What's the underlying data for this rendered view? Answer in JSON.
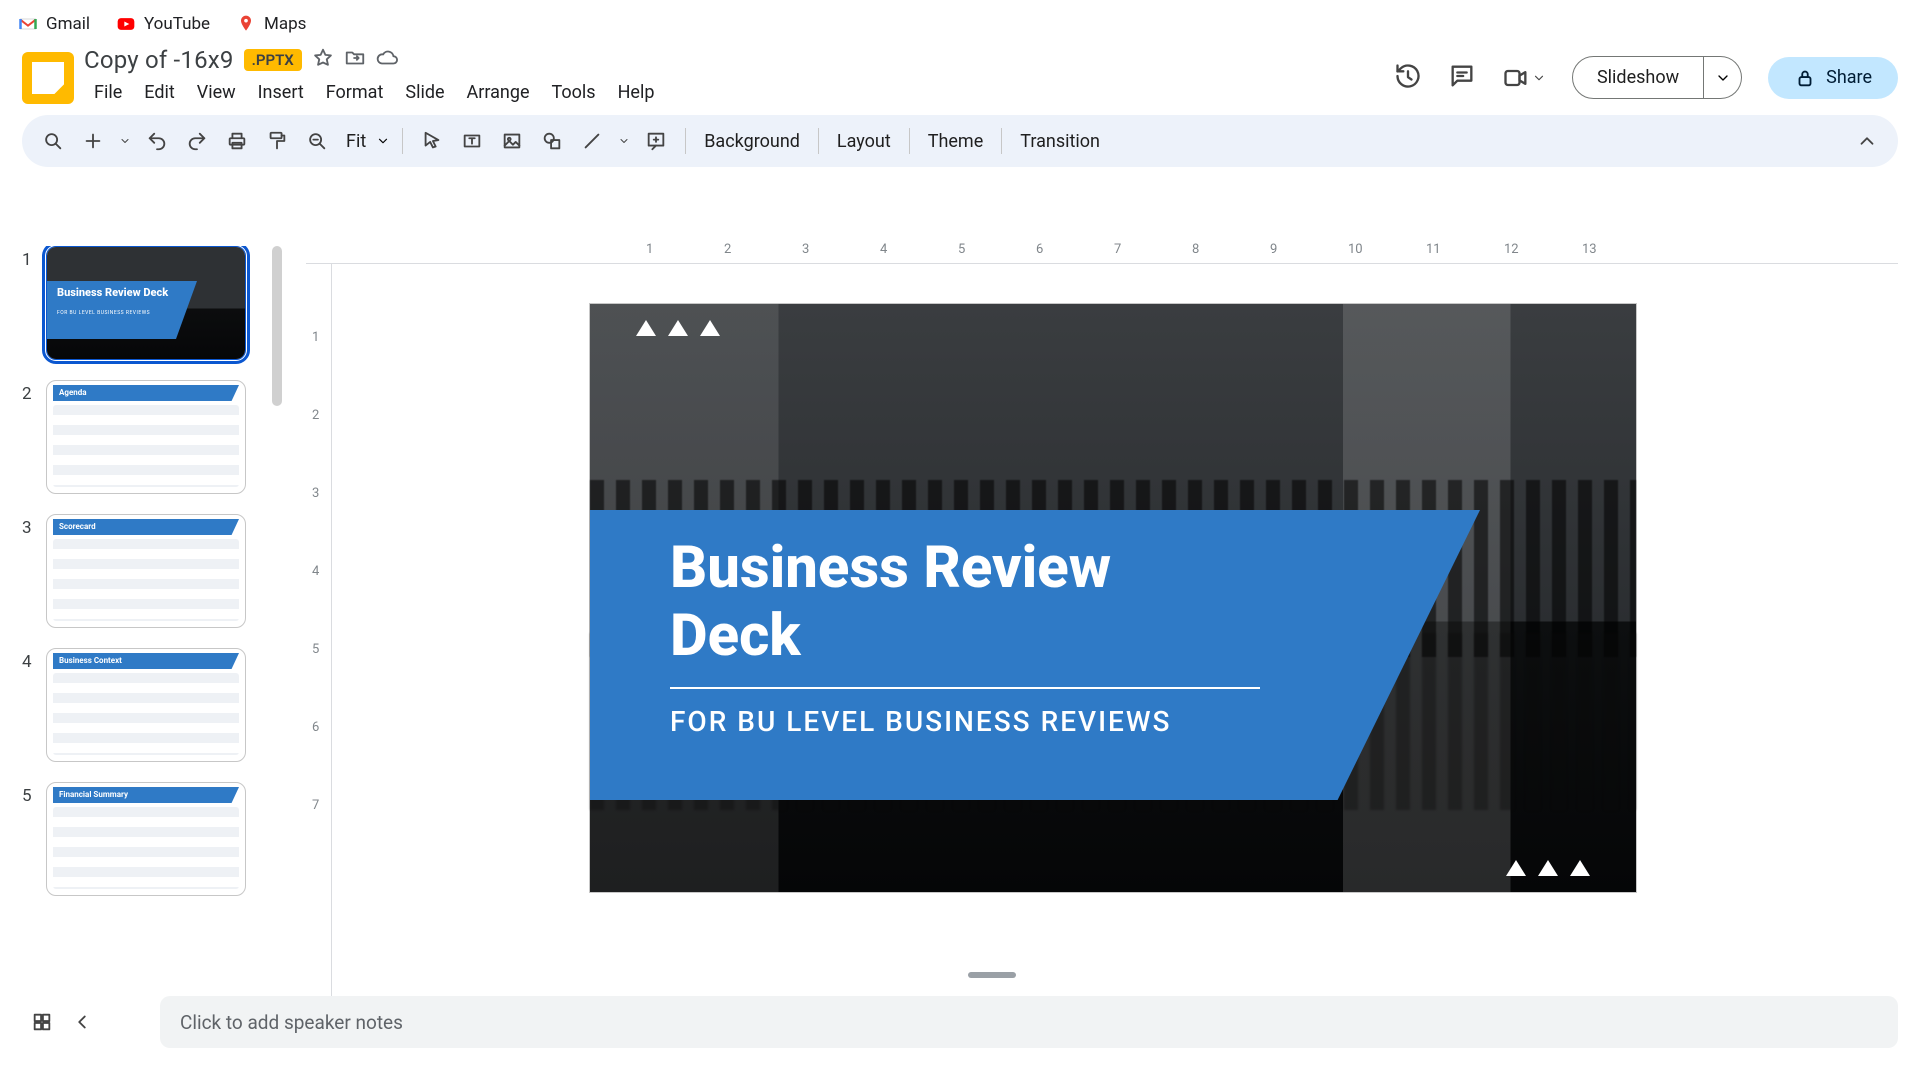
{
  "bookmarks": {
    "gmail": "Gmail",
    "youtube": "YouTube",
    "maps": "Maps"
  },
  "doc": {
    "title": "Copy of -16x9",
    "format_badge": ".PPTX"
  },
  "menu": {
    "file": "File",
    "edit": "Edit",
    "view": "View",
    "insert": "Insert",
    "format": "Format",
    "slide": "Slide",
    "arrange": "Arrange",
    "tools": "Tools",
    "help": "Help"
  },
  "header_actions": {
    "slideshow": "Slideshow",
    "share": "Share"
  },
  "toolbar": {
    "zoom": "Fit",
    "background": "Background",
    "layout": "Layout",
    "theme": "Theme",
    "transition": "Transition"
  },
  "ruler_h": [
    "1",
    "2",
    "3",
    "4",
    "5",
    "6",
    "7",
    "8",
    "9",
    "10",
    "11",
    "12",
    "13"
  ],
  "ruler_v": [
    "1",
    "2",
    "3",
    "4",
    "5",
    "6",
    "7"
  ],
  "slide": {
    "title_line1": "Business Review",
    "title_line2": "Deck",
    "subtitle": "FOR BU LEVEL BUSINESS REVIEWS"
  },
  "thumbs": [
    {
      "n": "1",
      "kind": "title",
      "title": "Business Review Deck",
      "sub": "FOR BU LEVEL BUSINESS REVIEWS"
    },
    {
      "n": "2",
      "kind": "content",
      "head": "Agenda"
    },
    {
      "n": "3",
      "kind": "content",
      "head": "Scorecard"
    },
    {
      "n": "4",
      "kind": "content",
      "head": "Business Context"
    },
    {
      "n": "5",
      "kind": "content",
      "head": "Financial Summary"
    }
  ],
  "notes_placeholder": "Click to add speaker notes",
  "colors": {
    "accent": "#2f7ac6",
    "toolbar_bg": "#edf2fa",
    "share_bg": "#c2e7ff",
    "badge": "#ffba00"
  }
}
